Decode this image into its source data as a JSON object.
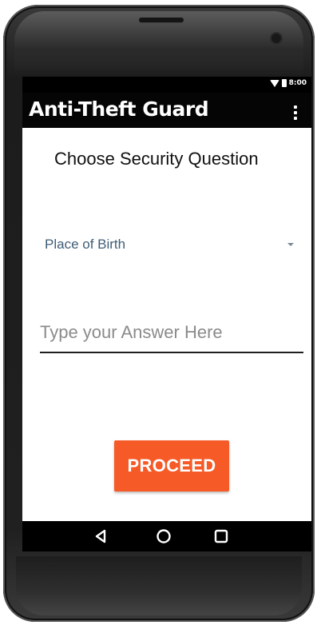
{
  "status_bar": {
    "time": "8:00",
    "icons": [
      "wifi-icon",
      "battery-icon"
    ]
  },
  "app_bar": {
    "title": "Anti-Theft Guard",
    "menu_icon": "overflow-menu-icon"
  },
  "main": {
    "heading": "Choose Security Question",
    "question_spinner": {
      "selected": "Place of Birth",
      "icon": "dropdown-arrow-icon"
    },
    "answer_field": {
      "value": "",
      "placeholder": "Type your Answer Here"
    },
    "proceed_label": "PROCEED"
  },
  "nav_bar": {
    "icons": [
      "back-icon",
      "home-icon",
      "recents-icon"
    ]
  },
  "colors": {
    "accent": "#f55a27",
    "app_bar": "#050505",
    "spinner_text": "#3f5d77"
  }
}
